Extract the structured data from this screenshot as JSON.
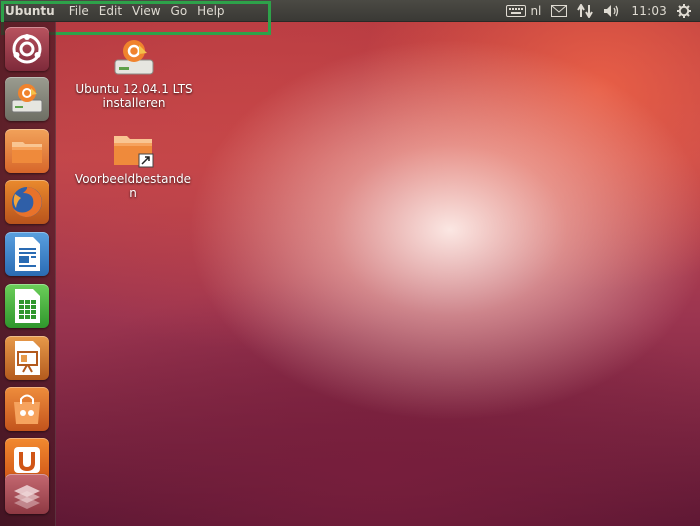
{
  "panel": {
    "app_name": "Ubuntu",
    "menu": [
      "File",
      "Edit",
      "View",
      "Go",
      "Help"
    ],
    "indicators": {
      "keyboard_icon": "keyboard-icon",
      "keyboard_layout": "nl",
      "messaging_icon": "envelope-icon",
      "network_icon": "network-updown-icon",
      "sound_icon": "speaker-icon",
      "clock": "11:03",
      "session_icon": "gear-icon"
    }
  },
  "launcher": {
    "items": [
      {
        "name": "dash-home",
        "icon": "ubuntu-logo-icon"
      },
      {
        "name": "install-ubuntu",
        "icon": "installer-icon"
      },
      {
        "name": "home-folder",
        "icon": "folder-icon"
      },
      {
        "name": "firefox",
        "icon": "firefox-icon"
      },
      {
        "name": "libreoffice-writer",
        "icon": "writer-icon"
      },
      {
        "name": "libreoffice-calc",
        "icon": "calc-icon"
      },
      {
        "name": "libreoffice-impress",
        "icon": "impress-icon"
      },
      {
        "name": "ubuntu-software-center",
        "icon": "shopping-bag-icon"
      },
      {
        "name": "ubuntu-one",
        "icon": "ubuntu-one-icon"
      },
      {
        "name": "system-settings",
        "icon": "settings-icon"
      }
    ]
  },
  "desktop": {
    "icons": [
      {
        "label": "Ubuntu 12.04.1 LTS installeren",
        "icon": "installer-icon"
      },
      {
        "label": "Voorbeeldbestanden",
        "icon": "folder-link-icon"
      }
    ]
  },
  "colors": {
    "highlight_border": "#2ea24a",
    "panel_bg": "#3c3b37",
    "panel_text": "#dfdbd2"
  }
}
